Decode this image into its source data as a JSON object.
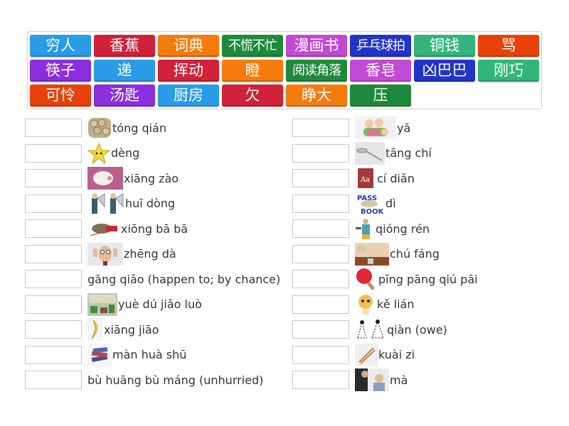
{
  "tile_colors": {
    "blue": "#2a9be6",
    "red": "#d0203a",
    "orange": "#f57c0c",
    "darkgreen": "#1f8a3c",
    "magenta": "#c04ad6",
    "navy": "#2234c8",
    "seagreen": "#32b57a",
    "vermilion": "#e8420a",
    "purple": "#8a2ee0"
  },
  "word_bank": [
    {
      "text": "穷人",
      "color": "blue"
    },
    {
      "text": "香蕉",
      "color": "red"
    },
    {
      "text": "词典",
      "color": "orange"
    },
    {
      "text": "不慌不忙",
      "color": "darkgreen"
    },
    {
      "text": "漫画书",
      "color": "magenta"
    },
    {
      "text": "乒乓球拍",
      "color": "navy"
    },
    {
      "text": "铜钱",
      "color": "seagreen"
    },
    {
      "text": "骂",
      "color": "vermilion"
    },
    {
      "text": "筷子",
      "color": "purple"
    },
    {
      "text": "递",
      "color": "blue"
    },
    {
      "text": "挥动",
      "color": "red"
    },
    {
      "text": "瞪",
      "color": "orange"
    },
    {
      "text": "阅读角落",
      "color": "darkgreen"
    },
    {
      "text": "香皂",
      "color": "magenta"
    },
    {
      "text": "凶巴巴",
      "color": "navy"
    },
    {
      "text": "刚巧",
      "color": "seagreen"
    },
    {
      "text": "可怜",
      "color": "vermilion"
    },
    {
      "text": "汤匙",
      "color": "purple"
    },
    {
      "text": "厨房",
      "color": "blue"
    },
    {
      "text": "欠",
      "color": "red"
    },
    {
      "text": "睁大",
      "color": "orange"
    },
    {
      "text": "压",
      "color": "darkgreen"
    }
  ],
  "left_items": [
    {
      "pinyin": "tóng qián",
      "image": "coins-image"
    },
    {
      "pinyin": "dèng",
      "image": "angry-star-image"
    },
    {
      "pinyin": "xiāng zào",
      "image": "soap-image"
    },
    {
      "pinyin": "huī dòng",
      "image": "waving-man-image"
    },
    {
      "pinyin": "xiōng bā bā",
      "image": "fierce-dog-image"
    },
    {
      "pinyin": "zhēng dà",
      "image": "wide-eyes-man-image"
    },
    {
      "pinyin": "gāng qiǎo  (happen to; by chance)",
      "image": null
    },
    {
      "pinyin": "yuè dú jiǎo luò",
      "image": "reading-corner-image"
    },
    {
      "pinyin": "xiāng jiāo",
      "image": "banana-image"
    },
    {
      "pinyin": "màn huà shū",
      "image": "comic-books-image"
    },
    {
      "pinyin": "bù huāng bù máng (unhurried)",
      "image": null
    }
  ],
  "right_items": [
    {
      "pinyin": "yā",
      "image": "kids-pile-image"
    },
    {
      "pinyin": "tāng chí",
      "image": "spoon-image"
    },
    {
      "pinyin": "cí diǎn",
      "image": "dictionary-image"
    },
    {
      "pinyin": "dì",
      "image": "pass-the-book-image"
    },
    {
      "pinyin": "qióng rén",
      "image": "poor-man-image"
    },
    {
      "pinyin": "chú fáng",
      "image": "kitchen-image"
    },
    {
      "pinyin": "pīng pāng qiú pāi",
      "image": "ping-pong-paddle-image"
    },
    {
      "pinyin": "kě lián",
      "image": "sad-cat-image"
    },
    {
      "pinyin": "qiàn (owe)",
      "image": "owe-figures-image"
    },
    {
      "pinyin": "kuài zi",
      "image": "chopsticks-image"
    },
    {
      "pinyin": "mà",
      "image": "scolding-image"
    }
  ]
}
